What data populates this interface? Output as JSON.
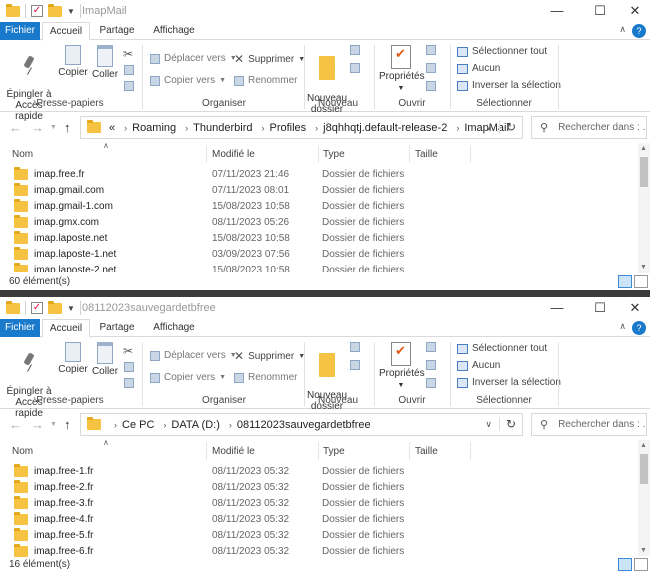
{
  "window_top": {
    "title": "ImapMail",
    "tabs": {
      "file": "Fichier",
      "home": "Accueil",
      "share": "Partage",
      "view": "Affichage"
    },
    "ribbon": {
      "pin": "Épingler à\nAccès rapide",
      "copy": "Copier",
      "paste": "Coller",
      "clipboard_group": "Presse-papiers",
      "move_to": "Déplacer vers",
      "copy_to": "Copier vers",
      "delete": "Supprimer",
      "rename": "Renommer",
      "organize_group": "Organiser",
      "new_folder": "Nouveau\ndossier",
      "new_group": "Nouveau",
      "properties": "Propriétés",
      "open_group": "Ouvrir",
      "select_all": "Sélectionner tout",
      "select_none": "Aucun",
      "invert_selection": "Inverser la sélection",
      "select_group": "Sélectionner"
    },
    "breadcrumb": [
      "Roaming",
      "Thunderbird",
      "Profiles",
      "j8qhhqtj.default-release-2",
      "ImapMail"
    ],
    "breadcrumb_prefix": "«",
    "search_placeholder": "Rechercher dans : ...",
    "columns": {
      "name": "Nom",
      "modified": "Modifié le",
      "type": "Type",
      "size": "Taille"
    },
    "rows": [
      {
        "name": "imap.free.fr",
        "date": "07/11/2023 21:46",
        "type": "Dossier de fichiers"
      },
      {
        "name": "imap.gmail.com",
        "date": "07/11/2023 08:01",
        "type": "Dossier de fichiers"
      },
      {
        "name": "imap.gmail-1.com",
        "date": "15/08/2023 10:58",
        "type": "Dossier de fichiers"
      },
      {
        "name": "imap.gmx.com",
        "date": "08/11/2023 05:26",
        "type": "Dossier de fichiers"
      },
      {
        "name": "imap.laposte.net",
        "date": "15/08/2023 10:58",
        "type": "Dossier de fichiers"
      },
      {
        "name": "imap.laposte-1.net",
        "date": "03/09/2023 07:56",
        "type": "Dossier de fichiers"
      },
      {
        "name": "imap.laposte-2.net",
        "date": "15/08/2023 10:58",
        "type": "Dossier de fichiers"
      }
    ],
    "status_count": "60 élément(s)"
  },
  "window_bottom": {
    "title": "08112023sauvegardetbfree",
    "tabs": {
      "file": "Fichier",
      "home": "Accueil",
      "share": "Partage",
      "view": "Affichage"
    },
    "ribbon": {
      "pin": "Épingler à\nAccès rapide",
      "copy": "Copier",
      "paste": "Coller",
      "clipboard_group": "Presse-papiers",
      "move_to": "Déplacer vers",
      "copy_to": "Copier vers",
      "delete": "Supprimer",
      "rename": "Renommer",
      "organize_group": "Organiser",
      "new_folder": "Nouveau\ndossier",
      "new_group": "Nouveau",
      "properties": "Propriétés",
      "open_group": "Ouvrir",
      "select_all": "Sélectionner tout",
      "select_none": "Aucun",
      "invert_selection": "Inverser la sélection",
      "select_group": "Sélectionner"
    },
    "breadcrumb": [
      "Ce PC",
      "DATA (D:)",
      "08112023sauvegardetbfree"
    ],
    "breadcrumb_prefix": "",
    "search_placeholder": "Rechercher dans : ...",
    "columns": {
      "name": "Nom",
      "modified": "Modifié le",
      "type": "Type",
      "size": "Taille"
    },
    "rows": [
      {
        "name": "imap.free-1.fr",
        "date": "08/11/2023 05:32",
        "type": "Dossier de fichiers"
      },
      {
        "name": "imap.free-2.fr",
        "date": "08/11/2023 05:32",
        "type": "Dossier de fichiers"
      },
      {
        "name": "imap.free-3.fr",
        "date": "08/11/2023 05:32",
        "type": "Dossier de fichiers"
      },
      {
        "name": "imap.free-4.fr",
        "date": "08/11/2023 05:32",
        "type": "Dossier de fichiers"
      },
      {
        "name": "imap.free-5.fr",
        "date": "08/11/2023 05:32",
        "type": "Dossier de fichiers"
      },
      {
        "name": "imap.free-6.fr",
        "date": "08/11/2023 05:32",
        "type": "Dossier de fichiers"
      }
    ],
    "status_count": "16 élément(s)"
  },
  "colors": {
    "accent": "#1979ca",
    "folder": "#f5c242",
    "separator_bar": "#3c3c3c"
  },
  "icons": [
    "folder-icon",
    "checkbox-icon",
    "pin-icon",
    "copy-icon",
    "paste-icon",
    "delete-icon",
    "new-folder-icon",
    "properties-icon",
    "select-all-icon",
    "refresh-icon",
    "search-icon",
    "up-arrow-icon"
  ]
}
